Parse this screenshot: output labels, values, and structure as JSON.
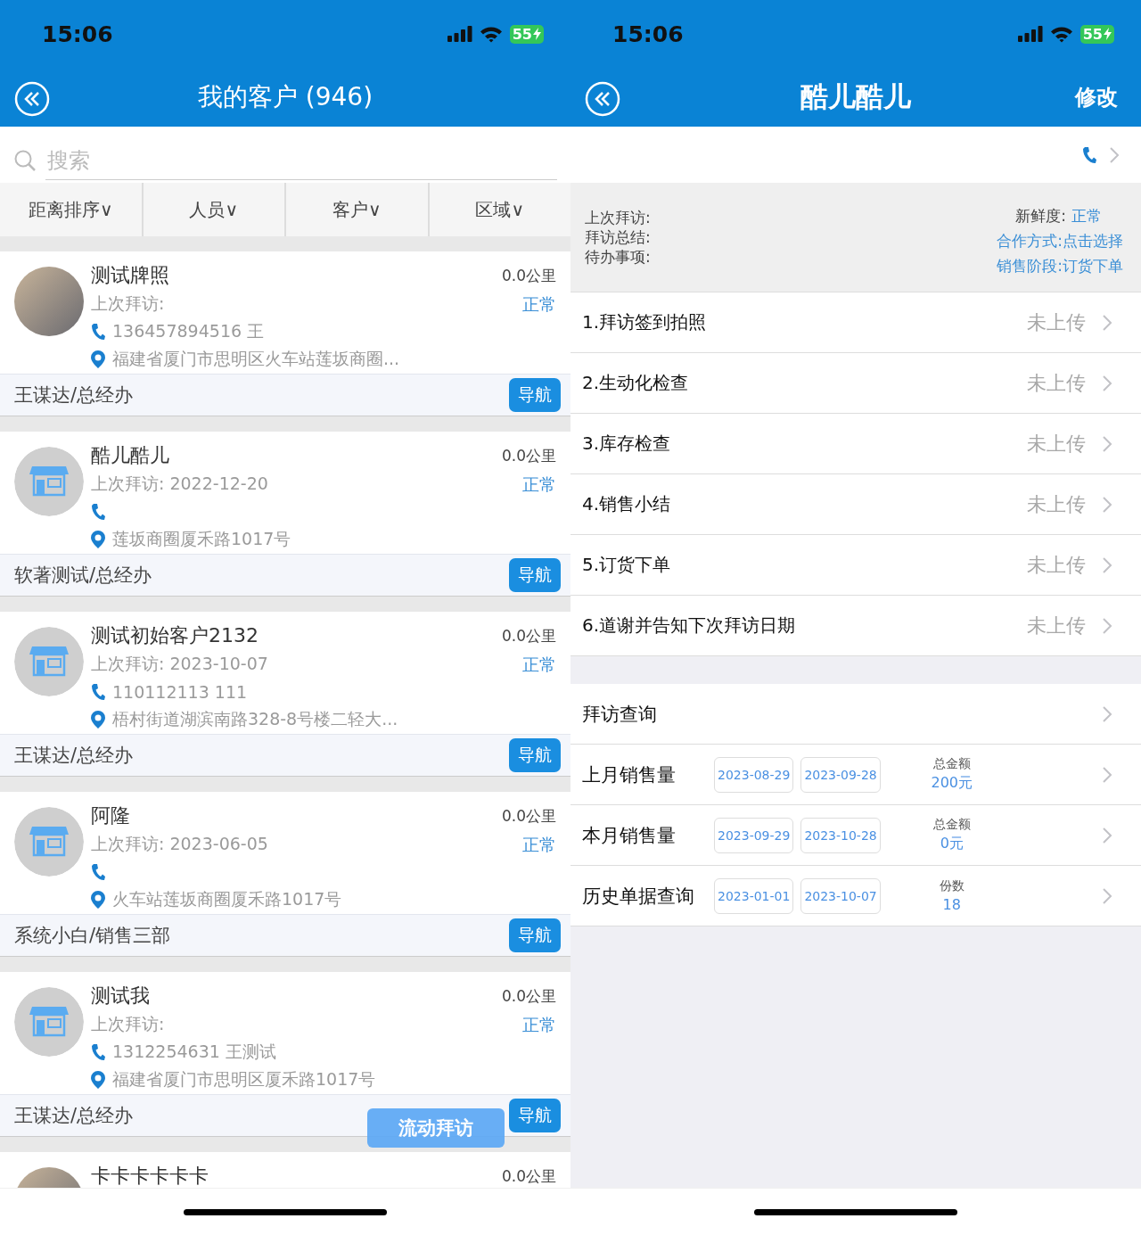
{
  "left_screen": {
    "status_bar": {
      "time": "15:06",
      "battery": "55"
    },
    "nav_bar": {
      "title": "我的客户 (946)"
    },
    "search": {
      "placeholder": "搜索"
    },
    "filters": [
      {
        "label": "距离排序∨"
      },
      {
        "label": "人员∨"
      },
      {
        "label": "客户∨"
      },
      {
        "label": "区域∨"
      }
    ],
    "customers": [
      {
        "kind": "photo",
        "name": "测试牌照",
        "last_visit": "上次拜访:",
        "phone": "136457894516 王",
        "address": "福建省厦门市思明区火车站莲坂商圈...",
        "distance": "0.0公里",
        "status": "正常",
        "owner": "王谋达/总经办",
        "nav_button": "导航"
      },
      {
        "kind": "store",
        "name": "酷儿酷儿",
        "last_visit": "上次拜访:  2022-12-20",
        "address": "莲坂商圈厦禾路1017号",
        "distance": "0.0公里",
        "status": "正常",
        "owner": "软著测试/总经办",
        "nav_button": "导航"
      },
      {
        "kind": "store",
        "name": "测试初始客户2132",
        "last_visit": "上次拜访:  2023-10-07",
        "phone": "110112113 111",
        "address": "梧村街道湖滨南路328-8号楼二轻大...",
        "distance": "0.0公里",
        "status": "正常",
        "owner": "王谋达/总经办",
        "nav_button": "导航"
      },
      {
        "kind": "store",
        "name": "阿隆",
        "last_visit": "上次拜访:  2023-06-05",
        "address": "火车站莲坂商圈厦禾路1017号",
        "distance": "0.0公里",
        "status": "正常",
        "owner": "系统小白/销售三部",
        "nav_button": "导航"
      },
      {
        "kind": "store",
        "name": "测试我",
        "last_visit": "上次拜访:",
        "phone": "1312254631 王测试",
        "address": "福建省厦门市思明区厦禾路1017号",
        "distance": "0.0公里",
        "status": "正常",
        "owner": "王谋达/总经办",
        "nav_button": "导航"
      }
    ],
    "partial_customer": {
      "kind": "photo",
      "name": "卡卡卡卡卡卡",
      "distance": "0.0公里"
    },
    "floating_button": "流动拜访"
  },
  "right_screen": {
    "status_bar": {
      "time": "15:06",
      "battery": "55"
    },
    "nav_bar": {
      "title": "酷儿酷儿",
      "action": "修改"
    },
    "info": {
      "left": [
        "上次拜访:",
        "拜访总结:",
        "待办事项:"
      ],
      "freshness_label": "新鲜度:",
      "freshness_value": "正常",
      "links": [
        "合作方式:点击选择",
        "销售阶段:订货下单"
      ]
    },
    "steps": [
      {
        "label": "1.拜访签到拍照",
        "status": "未上传"
      },
      {
        "label": "2.生动化检查",
        "status": "未上传"
      },
      {
        "label": "3.库存检查",
        "status": "未上传"
      },
      {
        "label": "4.销售小结",
        "status": "未上传"
      },
      {
        "label": "5.订货下单",
        "status": "未上传"
      },
      {
        "label": "6.道谢并告知下次拜访日期",
        "status": "未上传"
      }
    ],
    "queries": [
      {
        "label": "拜访查询"
      },
      {
        "label": "上月销售量",
        "start": "2023-08-29",
        "end": "2023-09-28",
        "metric_label": "总金额",
        "metric_value": "200元"
      },
      {
        "label": "本月销售量",
        "start": "2023-09-29",
        "end": "2023-10-28",
        "metric_label": "总金额",
        "metric_value": "0元"
      },
      {
        "label": "历史单据查询",
        "start": "2023-01-01",
        "end": "2023-10-07",
        "metric_label": "份数",
        "metric_value": "18"
      }
    ]
  }
}
